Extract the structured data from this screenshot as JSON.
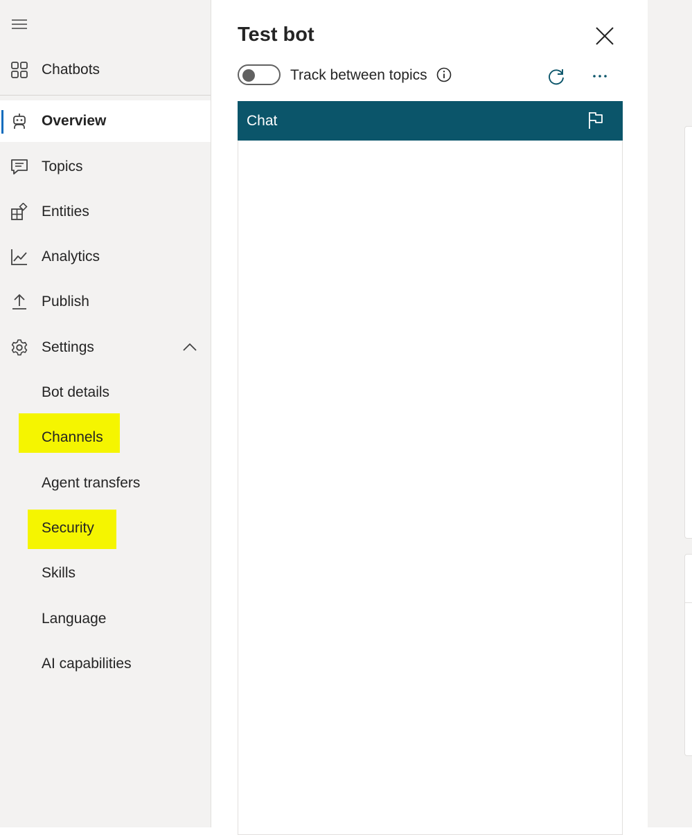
{
  "sidebar": {
    "top_items": [
      {
        "label": "Chatbots",
        "icon": "grid-icon"
      }
    ],
    "items": [
      {
        "label": "Overview",
        "icon": "bot-icon",
        "active": true
      },
      {
        "label": "Topics",
        "icon": "chat-bubble-icon"
      },
      {
        "label": "Entities",
        "icon": "entities-icon"
      },
      {
        "label": "Analytics",
        "icon": "line-chart-icon"
      },
      {
        "label": "Publish",
        "icon": "upload-icon"
      },
      {
        "label": "Settings",
        "icon": "gear-icon",
        "expanded": true
      }
    ],
    "settings_sub_items": [
      {
        "label": "Bot details"
      },
      {
        "label": "Channels",
        "highlighted": true
      },
      {
        "label": "Agent transfers"
      },
      {
        "label": "Security",
        "highlighted": true
      },
      {
        "label": "Skills"
      },
      {
        "label": "Language"
      },
      {
        "label": "AI capabilities"
      }
    ]
  },
  "test_bot": {
    "title": "Test bot",
    "toggle_label": "Track between topics",
    "toggle_on": false,
    "chat_header": "Chat"
  },
  "colors": {
    "chat_header_bg": "#0b556a",
    "highlight": "#f5f500",
    "accent": "#0f6cbd",
    "sidebar_bg": "#f3f2f1"
  }
}
